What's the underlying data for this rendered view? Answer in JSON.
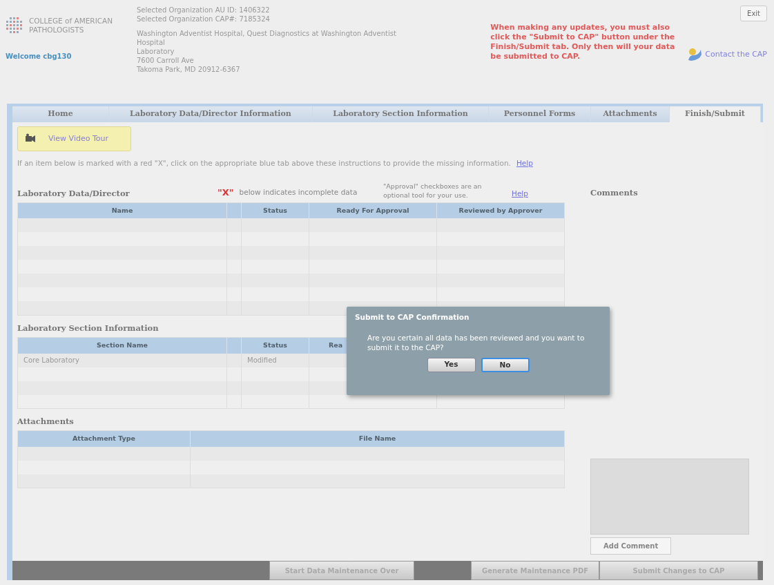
{
  "header": {
    "logo_text": [
      "COLLEGE of AMERICAN",
      "PATHOLOGISTS"
    ],
    "welcome": "Welcome cbg130",
    "org_lines": [
      "Selected Organization AU ID: 1406322",
      "Selected Organization CAP#: 7185324"
    ],
    "address_lines": [
      "Washington Adventist Hospital, Quest Diagnostics at Washington Adventist",
      "Hospital",
      "Laboratory",
      "7600 Carroll Ave",
      "Takoma Park, MD 20912-6367"
    ],
    "exit_button": "Exit",
    "notice": "When making any updates, you must also click the \"Submit to CAP\" button under the Finish/Submit tab. Only then will your data be submitted to CAP.",
    "contact_link": "Contact the CAP"
  },
  "tabs": [
    {
      "label": "Home",
      "selected": false
    },
    {
      "label": "Laboratory Data/Director Information",
      "selected": false
    },
    {
      "label": "Laboratory Section Information",
      "selected": false
    },
    {
      "label": "Personnel Forms",
      "selected": false
    },
    {
      "label": "Attachments",
      "selected": false
    },
    {
      "label": "Finish/Submit",
      "selected": true
    }
  ],
  "video_tour": "View Video Tour",
  "instructions": "If an item below is marked with a red \"X\", click on the appropriate blue tab above these instructions to provide the missing information.",
  "instructions_help": "Help",
  "lab_data": {
    "title": "Laboratory Data/Director",
    "x_mark": "\"X\"",
    "x_note": "below indicates incomplete data",
    "approval_note": "\"Approval\" checkboxes are an optional tool for your use.",
    "help": "Help",
    "columns": [
      "Name",
      "",
      "Status",
      "Ready For Approval",
      "Reviewed by Approver"
    ]
  },
  "section_info": {
    "title": "Laboratory Section Information",
    "columns": [
      "Section Name",
      "",
      "Status",
      "Rea",
      ""
    ],
    "rows": [
      [
        "Core Laboratory",
        "",
        "Modified",
        "",
        ""
      ]
    ]
  },
  "attachments": {
    "title": "Attachments",
    "columns": [
      "Attachment Type",
      "File Name"
    ]
  },
  "comments": {
    "title": "Comments",
    "add_button": "Add Comment"
  },
  "footer_buttons": [
    "Start Data Maintenance Over",
    "Generate Maintenance PDF",
    "Submit Changes to CAP"
  ],
  "dialog": {
    "title": "Submit to CAP Confirmation",
    "message": "Are you certain all data has been reviewed and you want to submit it to the CAP?",
    "buttons": [
      {
        "label": "Yes",
        "selected": false
      },
      {
        "label": "No",
        "selected": true
      }
    ]
  }
}
